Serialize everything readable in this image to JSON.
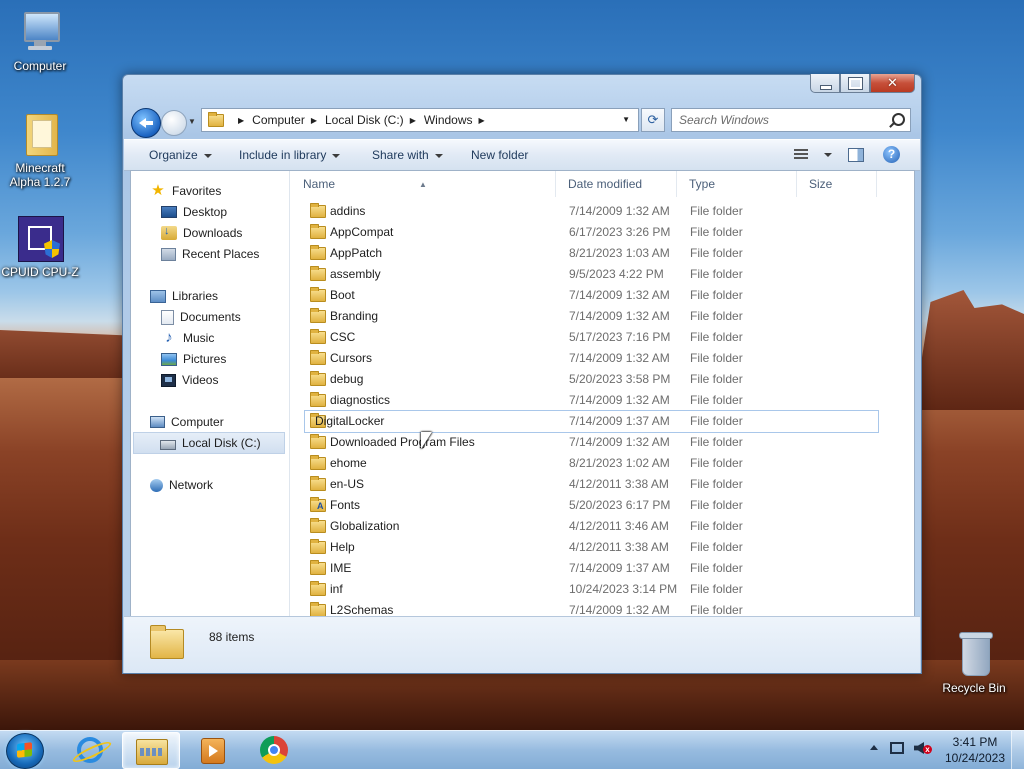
{
  "desktop": {
    "icons": [
      {
        "label": "Computer",
        "icon": "computer-icon"
      },
      {
        "label": "Minecraft Alpha 1.2.7",
        "icon": "minecraft-shortcut-icon"
      },
      {
        "label": "CPUID CPU-Z",
        "icon": "cpuz-icon"
      },
      {
        "label": "Recycle Bin",
        "icon": "recycle-bin-icon"
      }
    ]
  },
  "window": {
    "controls": {
      "close": "✕"
    },
    "address": {
      "crumbs": [
        "Computer",
        "Local Disk (C:)",
        "Windows"
      ]
    },
    "search": {
      "placeholder": "Search Windows"
    },
    "toolbar": {
      "organize": "Organize",
      "include_in_library": "Include in library",
      "share_with": "Share with",
      "new_folder": "New folder",
      "help": "?"
    },
    "nav": {
      "favorites": "Favorites",
      "desktop": "Desktop",
      "downloads": "Downloads",
      "recent_places": "Recent Places",
      "libraries": "Libraries",
      "documents": "Documents",
      "music": "Music",
      "pictures": "Pictures",
      "videos": "Videos",
      "computer": "Computer",
      "local_disk": "Local Disk (C:)",
      "network": "Network",
      "selected": "Local Disk (C:)"
    },
    "columns": {
      "name": "Name",
      "date": "Date modified",
      "type": "Type",
      "size": "Size"
    },
    "files": [
      {
        "name": "addins",
        "date": "7/14/2009 1:32 AM",
        "type": "File folder"
      },
      {
        "name": "AppCompat",
        "date": "6/17/2023 3:26 PM",
        "type": "File folder"
      },
      {
        "name": "AppPatch",
        "date": "8/21/2023 1:03 AM",
        "type": "File folder"
      },
      {
        "name": "assembly",
        "date": "9/5/2023 4:22 PM",
        "type": "File folder"
      },
      {
        "name": "Boot",
        "date": "7/14/2009 1:32 AM",
        "type": "File folder"
      },
      {
        "name": "Branding",
        "date": "7/14/2009 1:32 AM",
        "type": "File folder"
      },
      {
        "name": "CSC",
        "date": "5/17/2023 7:16 PM",
        "type": "File folder"
      },
      {
        "name": "Cursors",
        "date": "7/14/2009 1:32 AM",
        "type": "File folder"
      },
      {
        "name": "debug",
        "date": "5/20/2023 3:58 PM",
        "type": "File folder"
      },
      {
        "name": "diagnostics",
        "date": "7/14/2009 1:32 AM",
        "type": "File folder"
      },
      {
        "name": "DigitalLocker",
        "date": "7/14/2009 1:37 AM",
        "type": "File folder"
      },
      {
        "name": "Downloaded Program Files",
        "date": "7/14/2009 1:32 AM",
        "type": "File folder"
      },
      {
        "name": "ehome",
        "date": "8/21/2023 1:02 AM",
        "type": "File folder"
      },
      {
        "name": "en-US",
        "date": "4/12/2011 3:38 AM",
        "type": "File folder"
      },
      {
        "name": "Fonts",
        "date": "5/20/2023 6:17 PM",
        "type": "File folder"
      },
      {
        "name": "Globalization",
        "date": "4/12/2011 3:46 AM",
        "type": "File folder"
      },
      {
        "name": "Help",
        "date": "4/12/2011 3:38 AM",
        "type": "File folder"
      },
      {
        "name": "IME",
        "date": "7/14/2009 1:37 AM",
        "type": "File folder"
      },
      {
        "name": "inf",
        "date": "10/24/2023 3:14 PM",
        "type": "File folder"
      },
      {
        "name": "L2Schemas",
        "date": "7/14/2009 1:32 AM",
        "type": "File folder"
      }
    ],
    "hovered_file": "DigitalLocker",
    "details": {
      "item_count": "88 items"
    },
    "scroll_position": 0.0
  },
  "taskbar": {
    "pinned": [
      "internet-explorer-icon",
      "windows-explorer-icon",
      "windows-media-player-icon",
      "google-chrome-icon"
    ],
    "active": "windows-explorer-icon",
    "clock": {
      "time": "3:41 PM",
      "date": "10/24/2023"
    },
    "volume_muted_badge": "x"
  },
  "colors": {
    "window_frame": "#b7d0ec",
    "selection": "#d1dff0",
    "hover_outline": "#a9c7ea",
    "close_button": "#c7503a"
  }
}
